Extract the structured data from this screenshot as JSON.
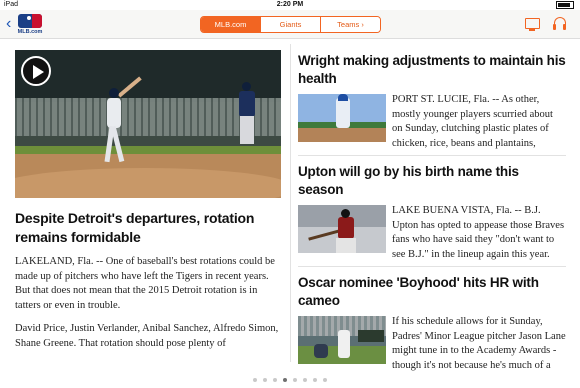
{
  "status_bar": {
    "carrier": "iPad",
    "time": "2:20 PM",
    "battery": ""
  },
  "nav": {
    "back_glyph": "‹",
    "logo_text": "MLB.com",
    "segments": [
      "MLB.com",
      "Giants",
      "Teams ›"
    ],
    "active_segment": 0,
    "icons": [
      "tv-icon",
      "headphones-icon"
    ],
    "accent_color": "#f26522"
  },
  "feature": {
    "has_video": true,
    "title": "Despite Detroit's departures, rotation remains formidable",
    "paragraphs": [
      "LAKELAND, Fla. -- One of baseball's best rotations could be made up of pitchers who have left the Tigers in recent years. But that does not mean that the 2015 Detroit rotation is in tatters or even in trouble.",
      "David Price, Justin Verlander, Anibal Sanchez, Alfredo Simon, Shane Greene. That rotation should pose plenty of"
    ]
  },
  "stories": [
    {
      "title": "Wright making adjustments to maintain his health",
      "summary": "PORT ST. LUCIE, Fla. -- As other, mostly younger players scurried about on Sunday, clutching plastic plates of chicken, rice, beans and plantains,"
    },
    {
      "title": "Upton will go by his birth name this season",
      "summary": "LAKE BUENA VISTA, Fla. -- B.J. Upton has opted to appease those Braves fans who have said they \"don't want to see B.J.\" in the lineup again this year. Now, the veteran outfielder"
    },
    {
      "title": "Oscar nominee 'Boyhood' hits HR with cameo",
      "summary": "If his schedule allows for it Sunday, Padres' Minor League pitcher Jason Lane might tune in to the Academy Awards - though it's not because he's much of a film buff."
    }
  ],
  "pager": {
    "count": 8,
    "active": 3
  }
}
